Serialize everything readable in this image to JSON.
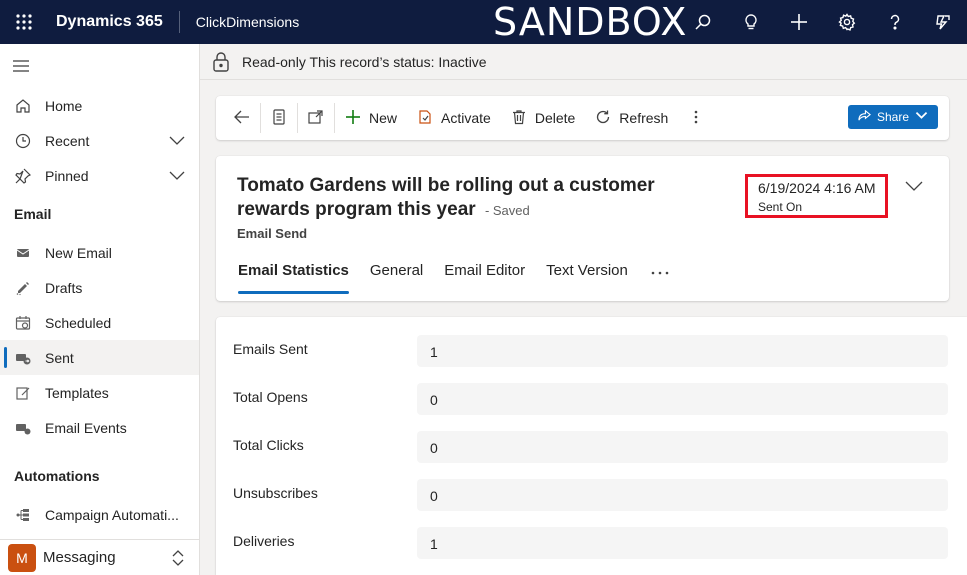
{
  "topbar": {
    "brand": "Dynamics 365",
    "app_name": "ClickDimensions",
    "environment": "SANDBOX",
    "icons": [
      "search-icon",
      "lightbulb-icon",
      "plus-icon",
      "gear-icon",
      "help-icon",
      "copilot-icon"
    ]
  },
  "sidebar": {
    "top_items": [
      {
        "label": "Home",
        "icon": "home-icon"
      },
      {
        "label": "Recent",
        "icon": "clock-icon"
      },
      {
        "label": "Pinned",
        "icon": "pin-icon"
      }
    ],
    "groups": [
      {
        "title": "Email",
        "items": [
          {
            "label": "New Email",
            "icon": "envelope-icon"
          },
          {
            "label": "Drafts",
            "icon": "pencil-icon"
          },
          {
            "label": "Scheduled",
            "icon": "calendar-icon"
          },
          {
            "label": "Sent",
            "icon": "sent-mail-icon"
          },
          {
            "label": "Templates",
            "icon": "template-icon"
          },
          {
            "label": "Email Events",
            "icon": "email-events-icon"
          }
        ]
      },
      {
        "title": "Automations",
        "items": [
          {
            "label": "Campaign Automati..."
          }
        ]
      }
    ],
    "area": {
      "badge": "M",
      "label": "Messaging",
      "badge_color": "#ca5010"
    }
  },
  "banner": {
    "text": "Read-only  This record’s status: Inactive"
  },
  "commands": {
    "new": "New",
    "activate": "Activate",
    "delete": "Delete",
    "refresh": "Refresh",
    "share": "Share"
  },
  "record": {
    "title": "Tomato Gardens will be rolling out a customer rewards program this year",
    "saved_status": "- Saved",
    "entity": "Email Send",
    "header_field": {
      "value": "6/19/2024 4:16 AM",
      "label": "Sent On"
    }
  },
  "tabs": [
    {
      "label": "Email Statistics",
      "active": true
    },
    {
      "label": "General"
    },
    {
      "label": "Email Editor"
    },
    {
      "label": "Text Version"
    }
  ],
  "stats": [
    {
      "label": "Emails Sent",
      "value": "1"
    },
    {
      "label": "Total Opens",
      "value": "0"
    },
    {
      "label": "Total Clicks",
      "value": "0"
    },
    {
      "label": "Unsubscribes",
      "value": "0"
    },
    {
      "label": "Deliveries",
      "value": "1"
    }
  ],
  "colors": {
    "topbar": "#0f1c3f",
    "accent": "#0f6cbd",
    "highlight": "#e81123"
  }
}
